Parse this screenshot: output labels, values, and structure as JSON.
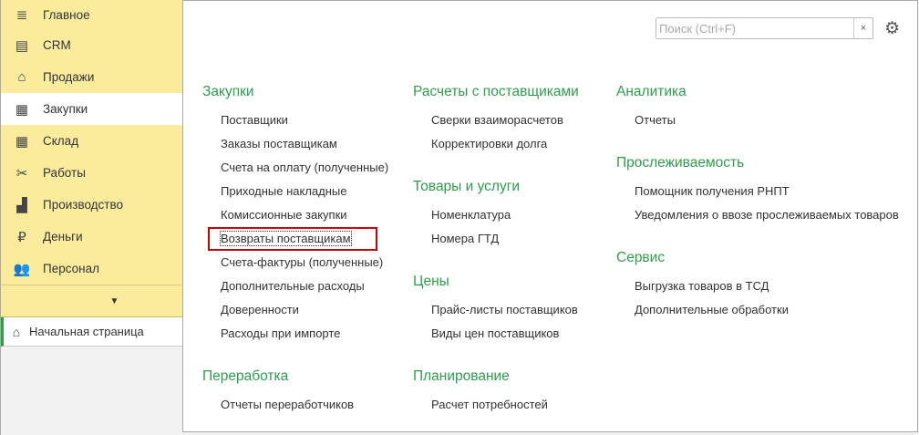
{
  "sidebar": {
    "items": [
      {
        "label": "Главное",
        "icon": "≣"
      },
      {
        "label": "CRM",
        "icon": "▤"
      },
      {
        "label": "Продажи",
        "icon": "⌂"
      },
      {
        "label": "Закупки",
        "icon": "▦"
      },
      {
        "label": "Склад",
        "icon": "▦"
      },
      {
        "label": "Работы",
        "icon": "✂"
      },
      {
        "label": "Производство",
        "icon": "▟"
      },
      {
        "label": "Деньги",
        "icon": "₽"
      },
      {
        "label": "Персонал",
        "icon": "👥"
      }
    ],
    "more_icon": "▼",
    "home": {
      "label": "Начальная страница",
      "icon": "⌂"
    }
  },
  "search": {
    "placeholder": "Поиск (Ctrl+F)",
    "clear": "×"
  },
  "settings_icon": "⚙",
  "columns": [
    [
      {
        "title": "Закупки",
        "items": [
          "Поставщики",
          "Заказы поставщикам",
          "Счета на оплату (полученные)",
          "Приходные накладные",
          "Комиссионные закупки",
          "Возвраты поставщикам",
          "Счета-фактуры (полученные)",
          "Дополнительные расходы",
          "Доверенности",
          "Расходы при импорте"
        ]
      },
      {
        "title": "Переработка",
        "items": [
          "Отчеты переработчиков"
        ]
      }
    ],
    [
      {
        "title": "Расчеты с поставщиками",
        "items": [
          "Сверки взаиморасчетов",
          "Корректировки долга"
        ]
      },
      {
        "title": "Товары и услуги",
        "items": [
          "Номенклатура",
          "Номера ГТД"
        ]
      },
      {
        "title": "Цены",
        "items": [
          "Прайс-листы поставщиков",
          "Виды цен поставщиков"
        ]
      },
      {
        "title": "Планирование",
        "items": [
          "Расчет потребностей"
        ]
      }
    ],
    [
      {
        "title": "Аналитика",
        "items": [
          "Отчеты"
        ]
      },
      {
        "title": "Прослеживаемость",
        "items": [
          "Помощник получения РНПТ",
          "Уведомления о ввозе прослеживаемых товаров"
        ]
      },
      {
        "title": "Сервис",
        "items": [
          "Выгрузка товаров в ТСД",
          "Дополнительные обработки"
        ]
      }
    ]
  ]
}
